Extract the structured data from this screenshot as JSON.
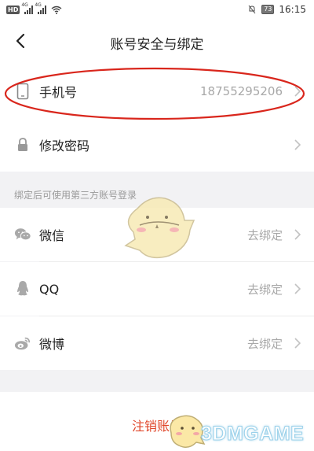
{
  "status_bar": {
    "hd_label": "HD",
    "signal1_label": "4G",
    "signal2_label": "4G",
    "battery": "73",
    "time": "16:15"
  },
  "header": {
    "title": "账号安全与绑定"
  },
  "account": {
    "phone_label": "手机号",
    "phone_value": "18755295206",
    "password_label": "修改密码"
  },
  "third_party": {
    "section_title": "绑定后可使用第三方账号登录",
    "items": [
      {
        "label": "微信",
        "action": "去绑定",
        "icon": "wechat-icon"
      },
      {
        "label": "QQ",
        "action": "去绑定",
        "icon": "qq-icon"
      },
      {
        "label": "微博",
        "action": "去绑定",
        "icon": "weibo-icon"
      }
    ]
  },
  "footer": {
    "logout_label": "注销账号"
  },
  "watermark": "3DMGAME",
  "colors": {
    "accent_red": "#e0462a",
    "annotation_red": "#d9261c",
    "secondary_text": "#a8a8a8",
    "background": "#f2f2f4"
  }
}
